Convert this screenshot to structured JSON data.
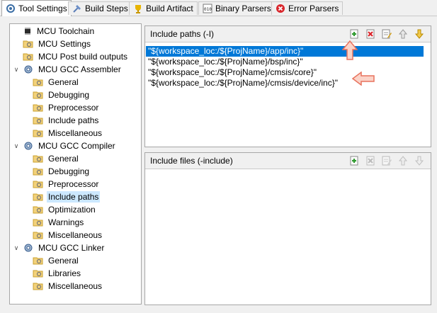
{
  "tabs": [
    {
      "label": "Tool Settings",
      "icon": "tool-settings-icon",
      "active": true
    },
    {
      "label": "Build Steps",
      "icon": "build-steps-icon"
    },
    {
      "label": "Build Artifact",
      "icon": "build-artifact-icon"
    },
    {
      "label": "Binary Parsers",
      "icon": "binary-parsers-icon"
    },
    {
      "label": "Error Parsers",
      "icon": "error-parsers-icon"
    }
  ],
  "tree": [
    {
      "label": "MCU Toolchain",
      "level": 0,
      "icon": "chip-icon"
    },
    {
      "label": "MCU Settings",
      "level": 0,
      "icon": "settings-folder-icon"
    },
    {
      "label": "MCU Post build outputs",
      "level": 0,
      "icon": "settings-folder-icon"
    },
    {
      "label": "MCU GCC Assembler",
      "level": 0,
      "icon": "gear-icon",
      "expanded": true
    },
    {
      "label": "General",
      "level": 1,
      "icon": "settings-folder-icon"
    },
    {
      "label": "Debugging",
      "level": 1,
      "icon": "settings-folder-icon"
    },
    {
      "label": "Preprocessor",
      "level": 1,
      "icon": "settings-folder-icon"
    },
    {
      "label": "Include paths",
      "level": 1,
      "icon": "settings-folder-icon"
    },
    {
      "label": "Miscellaneous",
      "level": 1,
      "icon": "settings-folder-icon"
    },
    {
      "label": "MCU GCC Compiler",
      "level": 0,
      "icon": "gear-icon",
      "expanded": true
    },
    {
      "label": "General",
      "level": 1,
      "icon": "settings-folder-icon"
    },
    {
      "label": "Debugging",
      "level": 1,
      "icon": "settings-folder-icon"
    },
    {
      "label": "Preprocessor",
      "level": 1,
      "icon": "settings-folder-icon"
    },
    {
      "label": "Include paths",
      "level": 1,
      "icon": "settings-folder-icon",
      "selected": true
    },
    {
      "label": "Optimization",
      "level": 1,
      "icon": "settings-folder-icon"
    },
    {
      "label": "Warnings",
      "level": 1,
      "icon": "settings-folder-icon"
    },
    {
      "label": "Miscellaneous",
      "level": 1,
      "icon": "settings-folder-icon"
    },
    {
      "label": "MCU GCC Linker",
      "level": 0,
      "icon": "gear-icon",
      "expanded": true
    },
    {
      "label": "General",
      "level": 1,
      "icon": "settings-folder-icon"
    },
    {
      "label": "Libraries",
      "level": 1,
      "icon": "settings-folder-icon"
    },
    {
      "label": "Miscellaneous",
      "level": 1,
      "icon": "settings-folder-icon"
    }
  ],
  "include_paths": {
    "title": "Include paths (-I)",
    "items": [
      "\"${workspace_loc:/${ProjName}/app/inc}\"",
      "\"${workspace_loc:/${ProjName}/bsp/inc}\"",
      "\"${workspace_loc:/${ProjName}/cmsis/core}\"",
      "\"${workspace_loc:/${ProjName}/cmsis/device/inc}\""
    ],
    "selected_index": 0
  },
  "include_files": {
    "title": "Include files (-include)",
    "items": []
  },
  "colors": {
    "selection": "#0078d7",
    "tree_selection": "#cce8ff",
    "annotation_arrow": "#e8735e"
  }
}
